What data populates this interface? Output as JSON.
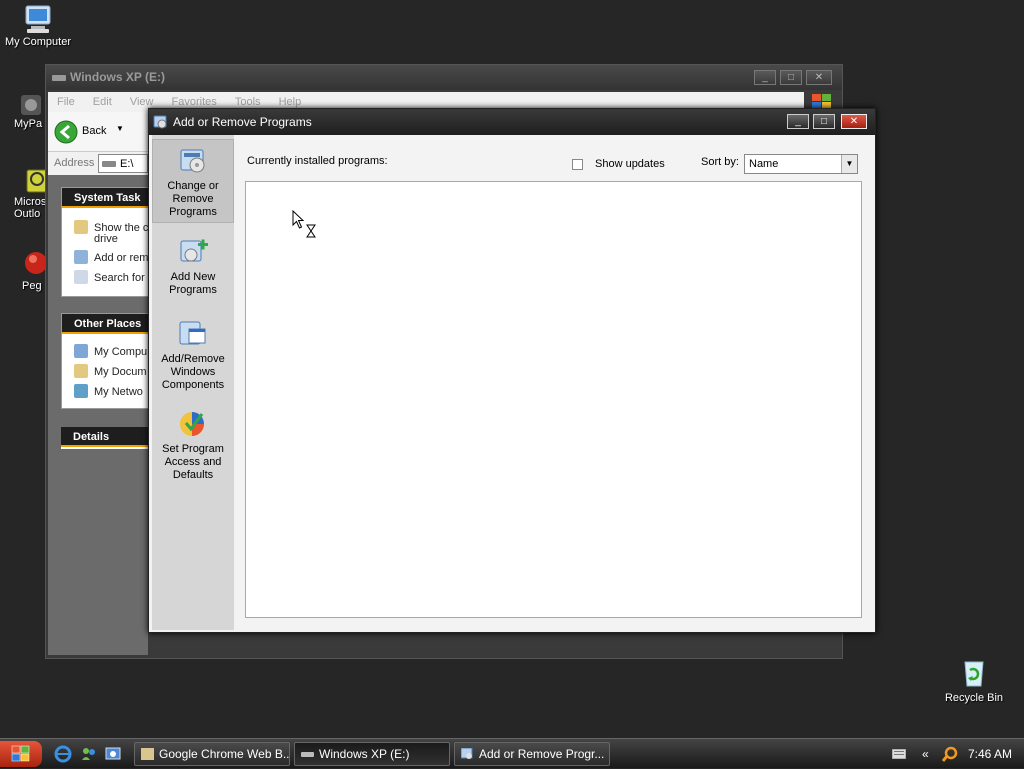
{
  "desktop": {
    "icons": [
      {
        "label": "My Computer"
      },
      {
        "label": "MyPa"
      },
      {
        "label": "Micros"
      },
      {
        "label": "Outlo"
      },
      {
        "label": "Peg"
      },
      {
        "label": "Recycle Bin"
      }
    ]
  },
  "explorer": {
    "title": "Windows XP (E:)",
    "menu": [
      "File",
      "Edit",
      "View",
      "Favorites",
      "Tools",
      "Help"
    ],
    "back_label": "Back",
    "address_label": "Address",
    "address_value": "E:\\",
    "system_tasks": {
      "header": "System Task",
      "items": [
        "Show the c",
        "drive",
        "Add or rem",
        "Search for"
      ]
    },
    "other_places": {
      "header": "Other Places",
      "items": [
        "My Compu",
        "My Docum",
        "My Netwo"
      ]
    },
    "details_header": "Details"
  },
  "arp": {
    "title": "Add or Remove Programs",
    "sidebar": [
      {
        "label": "Change or Remove Programs"
      },
      {
        "label": "Add New Programs"
      },
      {
        "label": "Add/Remove Windows Components"
      },
      {
        "label": "Set Program Access and Defaults"
      }
    ],
    "installed_label": "Currently installed programs:",
    "show_updates_label": "Show updates",
    "sort_by_label": "Sort by:",
    "sort_by_value": "Name"
  },
  "taskbar": {
    "buttons": [
      {
        "label": "Google Chrome Web B..."
      },
      {
        "label": "Windows XP (E:)"
      },
      {
        "label": "Add or Remove Progr..."
      }
    ],
    "tray_chevron": "«",
    "clock": "7:46 AM"
  },
  "colors": {
    "desktop": "#262626",
    "start_button": "#c0391f",
    "task_header_accent": "#f0a000"
  }
}
